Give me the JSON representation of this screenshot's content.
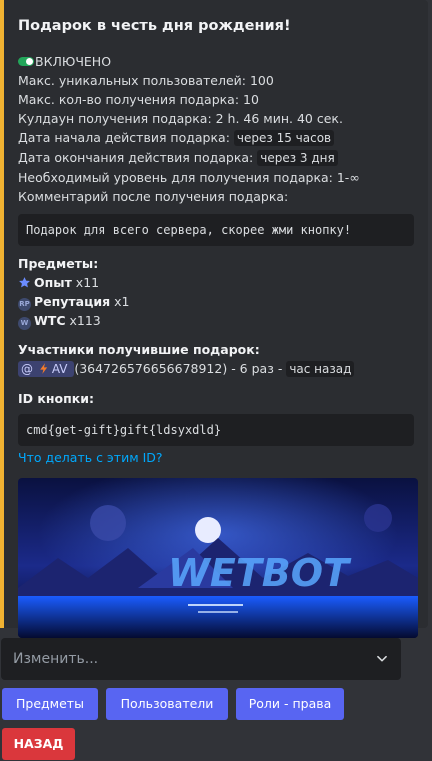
{
  "embed": {
    "title": "Подарок в честь дня рождения!",
    "status": "ВКЛЮЧЕНО",
    "max_users": "Макс. уникальных пользователей: 100",
    "max_claims": "Макс. кол-во получения подарка: 10",
    "cooldown": "Кулдаун получения подарка: 2 h. 46 мин. 40 сек.",
    "start_label": "Дата начала действия подарка:",
    "start_value": "через 15 часов",
    "end_label": "Дата окончания действия подарка:",
    "end_value": "через 3 дня",
    "level": "Необходимый уровень для получения подарка: 1-∞",
    "comment_label": "Комментарий после получения подарка:",
    "comment": "Подарок для всего сервера, скорее жми кнопку!",
    "items_title": "Предметы:",
    "items": [
      {
        "name": "Опыт",
        "qty": "x11",
        "icon": "star-icon"
      },
      {
        "name": "Репутация",
        "qty": "x1",
        "icon": "rp-icon"
      },
      {
        "name": "WTC",
        "qty": "x113",
        "icon": "wtc-coin-icon"
      }
    ],
    "participants_title": "Участники получившие подарок:",
    "participant": {
      "at": "@",
      "name": "AV",
      "id": "(364726576656678912) - 6 раз -",
      "time": "час назад"
    },
    "button_id_title": "ID кнопки:",
    "button_id": "cmd{get-gift}gift{ldsyxdld}",
    "help_link": "Что делать с этим ID?",
    "banner_text": "WETBOT",
    "accent_color": "#f0b232"
  },
  "select": {
    "placeholder": "Изменить..."
  },
  "buttons": {
    "items": "Предметы",
    "users": "Пользователи",
    "roles": "Роли - права",
    "back": "НАЗАД"
  }
}
